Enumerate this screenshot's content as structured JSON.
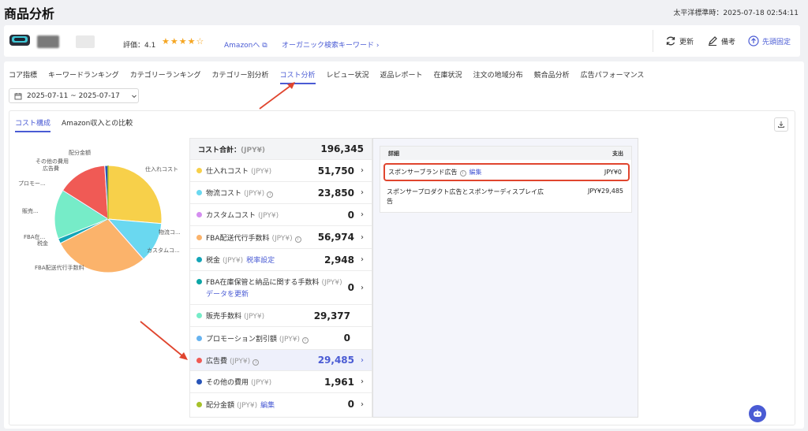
{
  "page": {
    "title": "商品分析",
    "timezone": "太平洋標準時：2025-07-18 02:54:11"
  },
  "product": {
    "rating_label": "評価：4.1",
    "stars": "★★★★☆",
    "amazon_link": "Amazonへ ⧉",
    "organic_link": "オーガニック検索キーワード ›"
  },
  "toolbar": {
    "refresh": "更新",
    "memo": "備考",
    "pin": "先頭固定"
  },
  "tabs": [
    {
      "label": "コア指標"
    },
    {
      "label": "キーワードランキング"
    },
    {
      "label": "カテゴリーランキング"
    },
    {
      "label": "カテゴリー別分析"
    },
    {
      "label": "コスト分析"
    },
    {
      "label": "レビュー状況"
    },
    {
      "label": "返品レポート"
    },
    {
      "label": "在庫状況"
    },
    {
      "label": "注文の地域分布"
    },
    {
      "label": "競合品分析"
    },
    {
      "label": "広告パフォーマンス"
    }
  ],
  "date_range": "2025-07-11 ~ 2025-07-17",
  "subtabs": [
    {
      "label": "コスト構成"
    },
    {
      "label": "Amazon収入との比較"
    }
  ],
  "colors": {
    "accent": "#4a5bd4",
    "highlight_border": "#e0452e"
  },
  "cost": {
    "total_label": "コスト合計：",
    "total_unit": "(JPY¥)",
    "total_value": "196,345",
    "rows": [
      {
        "name": "仕入れコスト",
        "unit": "(JPY¥)",
        "value": "51,750",
        "color": "#f7d04a",
        "info": false,
        "link": "",
        "chevron": true
      },
      {
        "name": "物流コスト",
        "unit": "(JPY¥)",
        "value": "23,850",
        "color": "#6ad8f0",
        "info": true,
        "link": "",
        "chevron": true
      },
      {
        "name": "カスタムコスト",
        "unit": "(JPY¥)",
        "value": "0",
        "color": "#d58ef0",
        "info": false,
        "link": "",
        "chevron": true
      },
      {
        "name": "FBA配送代行手数料",
        "unit": "(JPY¥)",
        "value": "56,974",
        "color": "#fbb36b",
        "info": true,
        "link": "",
        "chevron": true
      },
      {
        "name": "税金",
        "unit": "(JPY¥)",
        "value": "2,948",
        "color": "#14a5b8",
        "info": false,
        "link": "税率設定",
        "chevron": true
      },
      {
        "name": "FBA在庫保管と納品に関する手数料",
        "unit": "(JPY¥)",
        "value": "0",
        "color": "#0ca6a6",
        "info": false,
        "link": "データを更新",
        "chevron": true
      },
      {
        "name": "販売手数料",
        "unit": "(JPY¥)",
        "value": "29,377",
        "color": "#76ecc8",
        "info": false,
        "link": "",
        "chevron": false
      },
      {
        "name": "プロモーション割引額",
        "unit": "(JPY¥)",
        "value": "0",
        "color": "#67b3f0",
        "info": true,
        "link": "",
        "chevron": false
      },
      {
        "name": "広告費",
        "unit": "(JPY¥)",
        "value": "29,485",
        "color": "#f05a55",
        "info": true,
        "link": "",
        "chevron": true
      },
      {
        "name": "その他の費用",
        "unit": "(JPY¥)",
        "value": "1,961",
        "color": "#2754b8",
        "info": false,
        "link": "",
        "chevron": true
      },
      {
        "name": "配分金額",
        "unit": "(JPY¥)",
        "value": "0",
        "color": "#a6c12a",
        "info": false,
        "link": "編集",
        "chevron": true
      }
    ]
  },
  "detail": {
    "col_detail": "詳細",
    "col_amount": "支出",
    "row1_name": "スポンサーブランド広告",
    "row1_edit": "編集",
    "row1_value": "JPY¥0",
    "row2_name": "スポンサープロダクト広告とスポンサーディスプレイ広告",
    "row2_value": "JPY¥29,485"
  },
  "chart_data": {
    "type": "pie",
    "values": [
      51750,
      23850,
      0,
      56974,
      2948,
      0,
      29377,
      0,
      29485,
      1961,
      0
    ],
    "labels": [
      "仕入れコスト",
      "物流コ...",
      "カスタムコ...",
      "FBA配送代行手数料",
      "税金",
      "FBA在...",
      "販売...",
      "プロモー...",
      "広告費",
      "その他の費用",
      "配分金額"
    ]
  }
}
